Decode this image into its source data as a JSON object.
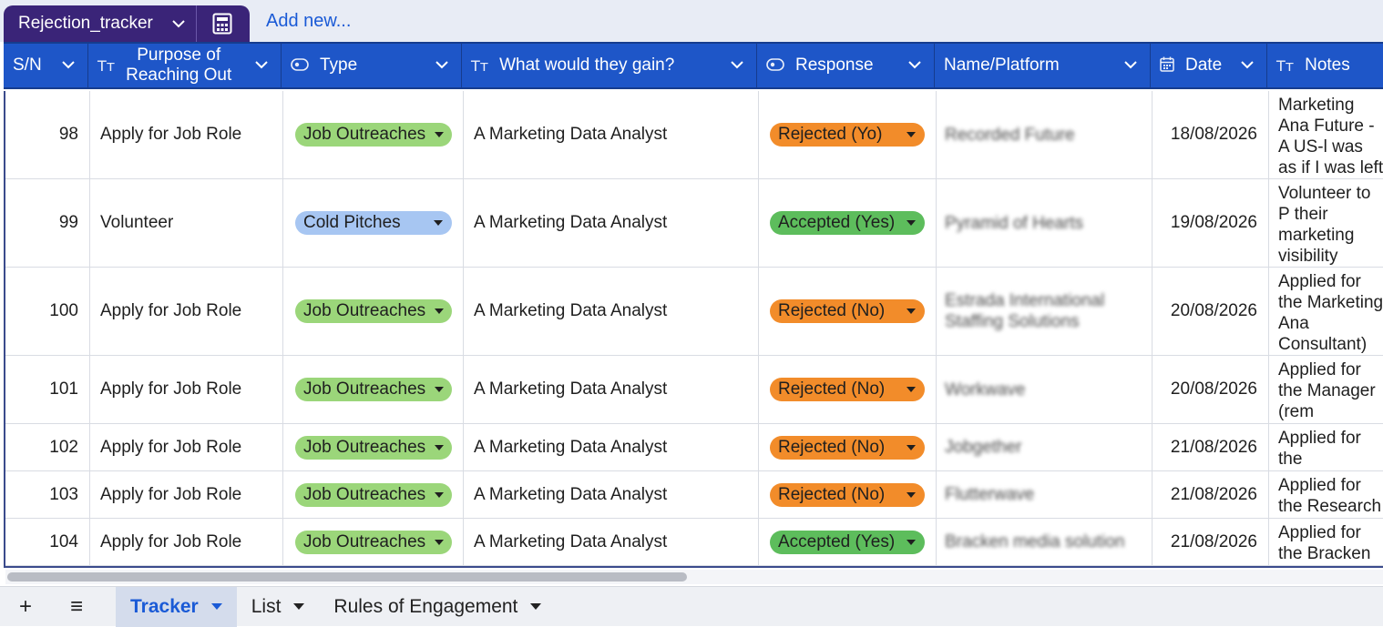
{
  "table_selector": {
    "name": "Rejection_tracker"
  },
  "toolbar": {
    "add_new_label": "Add new..."
  },
  "columns": [
    {
      "label": "S/N",
      "icon": ""
    },
    {
      "label": "Purpose of\nReaching Out",
      "icon": "text-type-icon"
    },
    {
      "label": "Type",
      "icon": "single-select-icon"
    },
    {
      "label": "What would they gain?",
      "icon": "text-type-icon"
    },
    {
      "label": "Response",
      "icon": "single-select-icon"
    },
    {
      "label": "Name/Platform",
      "icon": ""
    },
    {
      "label": "Date",
      "icon": "calendar-icon"
    },
    {
      "label": "Notes",
      "icon": "text-type-icon"
    }
  ],
  "rows": [
    {
      "sn": "98",
      "purpose": "Apply for Job Role",
      "type": "Job Outreaches",
      "gain": "A Marketing Data Analyst",
      "response": "Rejected (Yo)",
      "name": "Recorded Future",
      "date": "18/08/2026",
      "notes": "Marketing Ana Future - A US-l was as if I was left open spec"
    },
    {
      "sn": "99",
      "purpose": "Volunteer",
      "type": "Cold Pitches",
      "gain": "A Marketing Data Analyst",
      "response": "Accepted (Yes)",
      "name": "Pyramid of Hearts",
      "date": "19/08/2026",
      "notes": "Volunteer to P their marketing visibility online government gr"
    },
    {
      "sn": "100",
      "purpose": "Apply for Job Role",
      "type": "Job Outreaches",
      "gain": "A Marketing Data Analyst",
      "response": "Rejected (No)",
      "name": "Estrada International Staffing Solutions",
      "date": "20/08/2026",
      "notes": "Applied for the Marketing Ana Consultant) po Staffing Soluti"
    },
    {
      "sn": "101",
      "purpose": "Apply for Job Role",
      "type": "Job Outreaches",
      "gain": "A Marketing Data Analyst",
      "response": "Rejected (No)",
      "name": "Workwave",
      "date": "20/08/2026",
      "notes": "Applied for the Manager (rem company"
    },
    {
      "sn": "102",
      "purpose": "Apply for Job Role",
      "type": "Job Outreaches",
      "gain": "A Marketing Data Analyst",
      "response": "Rejected (No)",
      "name": "Jobgether",
      "date": "21/08/2026",
      "notes": "Applied for the Generation Ma"
    },
    {
      "sn": "103",
      "purpose": "Apply for Job Role",
      "type": "Job Outreaches",
      "gain": "A Marketing Data Analyst",
      "response": "Rejected (No)",
      "name": "Flutterwave",
      "date": "21/08/2026",
      "notes": "Applied for the Research Spec"
    },
    {
      "sn": "104",
      "purpose": "Apply for Job Role",
      "type": "Job Outreaches",
      "gain": "A Marketing Data Analyst",
      "response": "Accepted (Yes)",
      "name": "Bracken media solution",
      "date": "21/08/2026",
      "notes": "Applied for the Bracken media"
    }
  ],
  "colors": {
    "job_outreaches": "#9bd67a",
    "cold_pitches": "#a7c6f2",
    "rejected": "#f28c2a",
    "accepted": "#5dbd5c",
    "header_bg": "#1e56c8",
    "table_chip_bg": "#3a2478"
  },
  "tabs": [
    {
      "label": "Tracker",
      "active": true
    },
    {
      "label": "List",
      "active": false
    },
    {
      "label": "Rules of Engagement",
      "active": false
    }
  ],
  "bottom_buttons": {
    "add": "+",
    "menu": "≡"
  }
}
